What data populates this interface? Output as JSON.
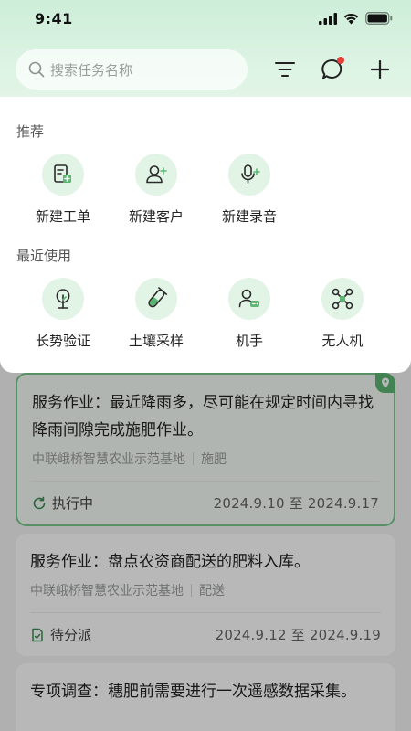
{
  "status_bar": {
    "time": "9:41"
  },
  "search": {
    "placeholder": "搜索任务名称"
  },
  "panel": {
    "recommend_title": "推荐",
    "recommend_items": [
      {
        "label": "新建工单",
        "icon": "new-work-order-icon"
      },
      {
        "label": "新建客户",
        "icon": "new-customer-icon"
      },
      {
        "label": "新建录音",
        "icon": "new-recording-icon"
      }
    ],
    "recent_title": "最近使用",
    "recent_items": [
      {
        "label": "长势验证",
        "icon": "growth-verify-icon"
      },
      {
        "label": "土壤采样",
        "icon": "soil-sampling-icon"
      },
      {
        "label": "机手",
        "icon": "operator-icon"
      },
      {
        "label": "无人机",
        "icon": "drone-icon"
      }
    ]
  },
  "tasks": [
    {
      "title": "服务作业：最近降雨多，尽可能在规定时间内寻找降雨间隙完成施肥作业。",
      "base": "中联峨桥智慧农业示范基地",
      "type": "施肥",
      "status": "执行中",
      "date": "2024.9.10 至 2024.9.17"
    },
    {
      "title": "服务作业：盘点农资商配送的肥料入库。",
      "base": "中联峨桥智慧农业示范基地",
      "type": "配送",
      "status": "待分派",
      "date": "2024.9.12 至 2024.9.19"
    },
    {
      "title": "专项调查：穗肥前需要进行一次遥感数据采集。"
    }
  ],
  "colors": {
    "accent": "#5db674",
    "icon_bg": "#e2f4e6",
    "notify": "#e9403c"
  }
}
